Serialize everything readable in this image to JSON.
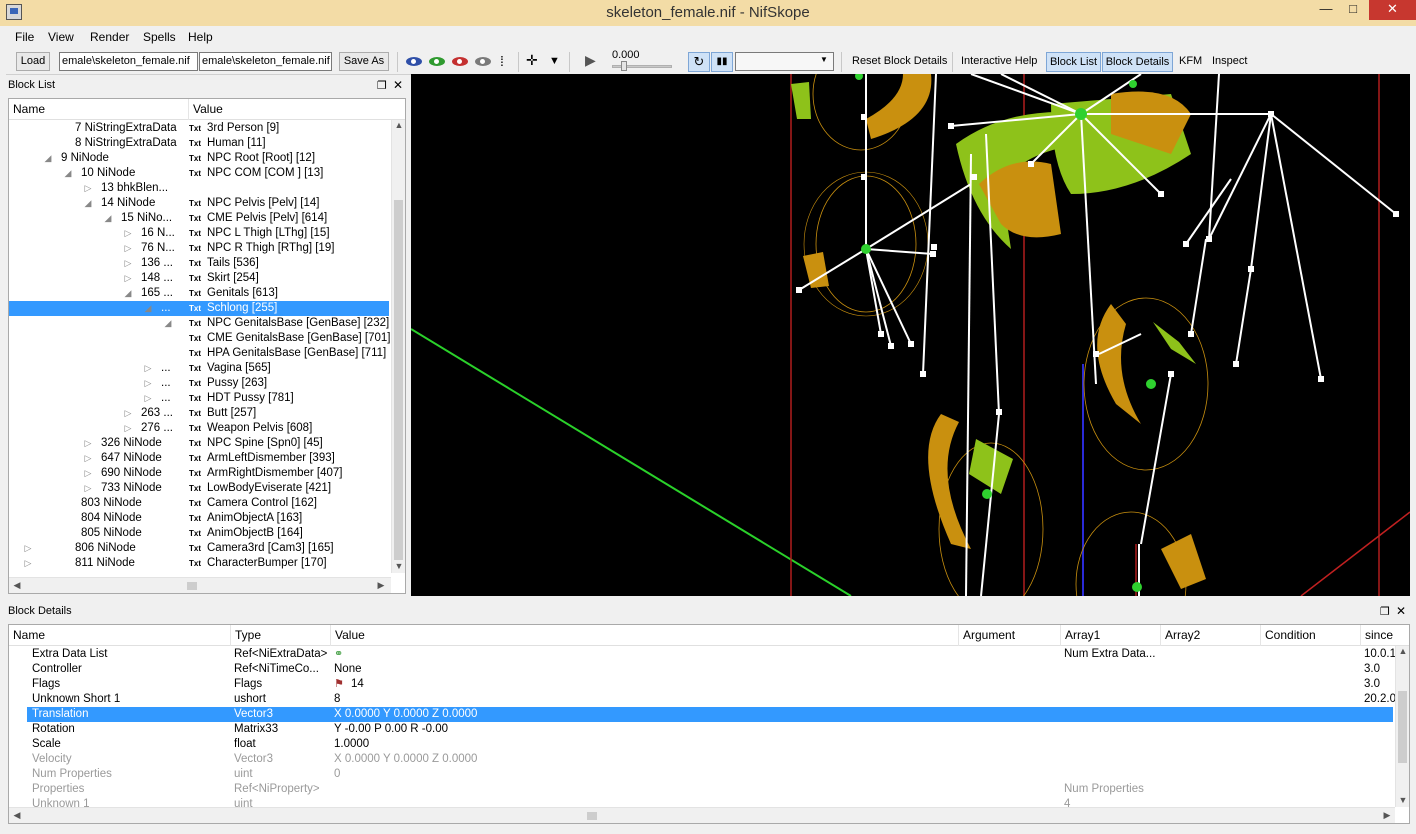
{
  "window": {
    "title": "skeleton_female.nif - NifSkope"
  },
  "menu": [
    "File",
    "View",
    "Render",
    "Spells",
    "Help"
  ],
  "toolbar": {
    "load_label": "Load",
    "load_path": "emale\\skeleton_female.nif",
    "save_path": "emale\\skeleton_female.nif",
    "save_as_label": "Save As",
    "time_value": "0.000",
    "reset_block_details": "Reset Block Details",
    "interactive_help": "Interactive Help",
    "block_list": "Block List",
    "block_details": "Block Details",
    "kfm": "KFM",
    "inspect": "Inspect"
  },
  "block_list": {
    "title": "Block List",
    "columns": {
      "name": "Name",
      "value": "Value"
    },
    "type_badge": "Txt",
    "rows": [
      {
        "name": "7 NiStringExtraData",
        "value": "3rd Person [9]",
        "indent": 0,
        "arrow": ""
      },
      {
        "name": "8 NiStringExtraData",
        "value": "Human [11]",
        "indent": 0,
        "arrow": ""
      },
      {
        "name": "9 NiNode",
        "value": "NPC Root [Root] [12]",
        "indent": 1,
        "arrow": "◢"
      },
      {
        "name": "10 NiNode",
        "value": "NPC COM [COM ] [13]",
        "indent": 2,
        "arrow": "◢"
      },
      {
        "name": "13 bhkBlen...",
        "value": "",
        "indent": 3,
        "arrow": "▷"
      },
      {
        "name": "14 NiNode",
        "value": "NPC Pelvis [Pelv] [14]",
        "indent": 3,
        "arrow": "◢"
      },
      {
        "name": "15 NiNo...",
        "value": "CME Pelvis [Pelv] [614]",
        "indent": 4,
        "arrow": "◢"
      },
      {
        "name": "16 N...",
        "value": "NPC L Thigh [LThg] [15]",
        "indent": 5,
        "arrow": "▷"
      },
      {
        "name": "76 N...",
        "value": "NPC R Thigh [RThg] [19]",
        "indent": 5,
        "arrow": "▷"
      },
      {
        "name": "136 ...",
        "value": "Tails [536]",
        "indent": 5,
        "arrow": "▷"
      },
      {
        "name": "148 ...",
        "value": "Skirt [254]",
        "indent": 5,
        "arrow": "▷"
      },
      {
        "name": "165 ...",
        "value": "Genitals [613]",
        "indent": 5,
        "arrow": "◢"
      },
      {
        "name": "...",
        "value": "Schlong [255]",
        "indent": 6,
        "arrow": "◢",
        "selected": true
      },
      {
        "name": "",
        "value": "NPC GenitalsBase [GenBase] [232]",
        "indent": 7,
        "arrow": "◢"
      },
      {
        "name": "",
        "value": "CME GenitalsBase [GenBase] [701]",
        "indent": 7,
        "arrow": ""
      },
      {
        "name": "",
        "value": "HPA GenitalsBase [GenBase] [711]",
        "indent": 7,
        "arrow": ""
      },
      {
        "name": "...",
        "value": "Vagina [565]",
        "indent": 6,
        "arrow": "▷"
      },
      {
        "name": "...",
        "value": "Pussy [263]",
        "indent": 6,
        "arrow": "▷"
      },
      {
        "name": "...",
        "value": "HDT Pussy [781]",
        "indent": 6,
        "arrow": "▷"
      },
      {
        "name": "263 ...",
        "value": "Butt [257]",
        "indent": 5,
        "arrow": "▷"
      },
      {
        "name": "276 ...",
        "value": "Weapon Pelvis [608]",
        "indent": 5,
        "arrow": "▷"
      },
      {
        "name": "326 NiNode",
        "value": "NPC Spine [Spn0] [45]",
        "indent": 3,
        "arrow": "▷"
      },
      {
        "name": "647 NiNode",
        "value": "ArmLeftDismember [393]",
        "indent": 3,
        "arrow": "▷"
      },
      {
        "name": "690 NiNode",
        "value": "ArmRightDismember [407]",
        "indent": 3,
        "arrow": "▷"
      },
      {
        "name": "733 NiNode",
        "value": "LowBodyEviserate [421]",
        "indent": 3,
        "arrow": "▷"
      },
      {
        "name": "803 NiNode",
        "value": "Camera Control [162]",
        "indent": 2,
        "arrow": ""
      },
      {
        "name": "804 NiNode",
        "value": "AnimObjectA [163]",
        "indent": 2,
        "arrow": ""
      },
      {
        "name": "805 NiNode",
        "value": "AnimObjectB [164]",
        "indent": 2,
        "arrow": ""
      },
      {
        "name": "806 NiNode",
        "value": "Camera3rd [Cam3] [165]",
        "indent": 0,
        "arrow": "▷"
      },
      {
        "name": "811 NiNode",
        "value": "CharacterBumper [170]",
        "indent": 0,
        "arrow": "▷"
      }
    ]
  },
  "block_details": {
    "title": "Block Details",
    "columns": [
      "Name",
      "Type",
      "Value",
      "Argument",
      "Array1",
      "Array2",
      "Condition",
      "since"
    ],
    "rows": [
      {
        "name": "Extra Data List",
        "type": "Ref<NiExtraData>",
        "value": "",
        "array1": "Num Extra Data...",
        "since": "10.0.1",
        "icon": "link"
      },
      {
        "name": "Controller",
        "type": "Ref<NiTimeCo...",
        "value": "None",
        "array1": "",
        "since": "3.0"
      },
      {
        "name": "Flags",
        "type": "Flags",
        "value": "14",
        "array1": "",
        "since": "3.0",
        "icon": "flag"
      },
      {
        "name": "Unknown Short 1",
        "type": "ushort",
        "value": "8",
        "array1": "",
        "since": "20.2.0"
      },
      {
        "name": "Translation",
        "type": "Vector3",
        "value": "X 0.0000 Y 0.0000 Z 0.0000",
        "array1": "",
        "since": "",
        "selected": true
      },
      {
        "name": "Rotation",
        "type": "Matrix33",
        "value": "Y -0.00 P 0.00 R -0.00",
        "array1": "",
        "since": ""
      },
      {
        "name": "Scale",
        "type": "float",
        "value": "1.0000",
        "array1": "",
        "since": ""
      },
      {
        "name": "Velocity",
        "type": "Vector3",
        "value": "X 0.0000 Y 0.0000 Z 0.0000",
        "array1": "",
        "since": "",
        "disabled": true
      },
      {
        "name": "Num Properties",
        "type": "uint",
        "value": "0",
        "array1": "",
        "since": "",
        "disabled": true
      },
      {
        "name": "Properties",
        "type": "Ref<NiProperty>",
        "value": "",
        "array1": "Num Properties",
        "since": "",
        "disabled": true
      },
      {
        "name": "Unknown 1",
        "type": "uint",
        "value": "",
        "array1": "4",
        "since": "",
        "disabled": true
      }
    ]
  },
  "colors": {
    "selection": "#3399ff",
    "titlebar": "#f3dca6",
    "close": "#c7372f",
    "bone_green": "#8ec21a",
    "bone_orange": "#c9900f"
  }
}
